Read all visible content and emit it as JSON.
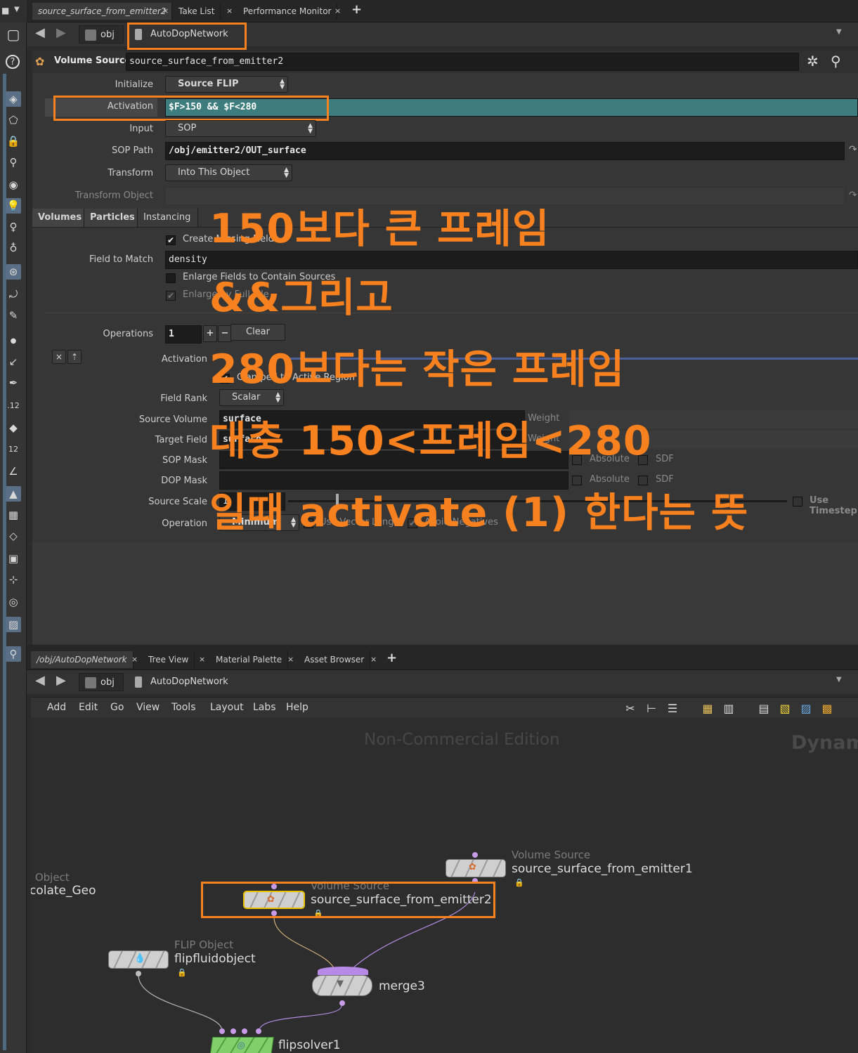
{
  "top_tabs": [
    {
      "label": "source_surface_from_emitter2"
    },
    {
      "label": "Take List"
    },
    {
      "label": "Performance Monitor"
    }
  ],
  "top_path": {
    "root": "obj",
    "current": "AutoDopNetwork"
  },
  "node_header": {
    "type": "Volume Source",
    "name": "source_surface_from_emitter2"
  },
  "params": {
    "initialize": {
      "label": "Initialize",
      "value": "Source FLIP"
    },
    "activation": {
      "label": "Activation",
      "value": "$F>150 && $F<280"
    },
    "input": {
      "label": "Input",
      "value": "SOP"
    },
    "sop_path": {
      "label": "SOP Path",
      "value": "/obj/emitter2/OUT_surface"
    },
    "transform": {
      "label": "Transform",
      "value": "Into This Object"
    },
    "transform_object": {
      "label": "Transform Object",
      "value": ""
    }
  },
  "content_tabs": [
    {
      "label": "Volumes"
    },
    {
      "label": "Particles"
    },
    {
      "label": "Instancing"
    }
  ],
  "volumes": {
    "create_missing": "Create Missing Fields",
    "field_to_match_label": "Field to Match",
    "field_to_match": "density",
    "enlarge_fields": "Enlarge Fields to Contain Sources",
    "enlarge_by_fulfill": "Enlarge by Full Tile",
    "operations_label": "Operations",
    "operations_value": "1",
    "clear_label": "Clear",
    "activation_label": "Activation",
    "clamped": "Clamped to Active Region",
    "field_rank_label": "Field Rank",
    "field_rank": "Scalar",
    "source_volume_label": "Source Volume",
    "source_volume": "surface",
    "target_field_label": "Target Field",
    "target_field": "surface",
    "weight_label": "Weight",
    "sop_mask_label": "SOP Mask",
    "dop_mask_label": "DOP Mask",
    "absolute_label": "Absolute",
    "sdf_label": "SDF",
    "source_scale_label": "Source Scale",
    "source_scale": "1",
    "use_timestep": "Use Timestep",
    "operation_label": "Operation",
    "operation": "Minimum",
    "use_vector_length": "Use Vector Length",
    "avoid_negatives": "Avoid Negatives"
  },
  "annotations": [
    "150보다 큰 프레임",
    "&&그리고",
    "280보다는 작은 프레임",
    "대충 150<프레임<280",
    "일때 activate (1) 한다는 뜻"
  ],
  "bottom_tabs": [
    {
      "label": "/obj/AutoDopNetwork"
    },
    {
      "label": "Tree View"
    },
    {
      "label": "Material Palette"
    },
    {
      "label": "Asset Browser"
    }
  ],
  "bottom_path": {
    "root": "obj",
    "current": "AutoDopNetwork"
  },
  "menu": [
    "Add",
    "Edit",
    "Go",
    "View",
    "Tools",
    "Layout",
    "Labs",
    "Help"
  ],
  "network": {
    "watermark": "Non-Commercial Edition",
    "context_label": "Dynam",
    "nodes": [
      {
        "type": "Volume Source",
        "name": "source_surface_from_emitter1"
      },
      {
        "type": "Volume Source",
        "name": "source_surface_from_emitter2"
      },
      {
        "type": "FLIP Object",
        "name": "flipfluidobject"
      },
      {
        "type": "",
        "name": "merge3"
      },
      {
        "type": "",
        "name": "flipsolver1"
      },
      {
        "type": ": Object",
        "name": "colate_Geo"
      }
    ]
  },
  "colors": {
    "accent": "#f7801f",
    "activation_field": "#3d7d7d",
    "selection": "#e6c200",
    "wire": "#b28ae0"
  }
}
